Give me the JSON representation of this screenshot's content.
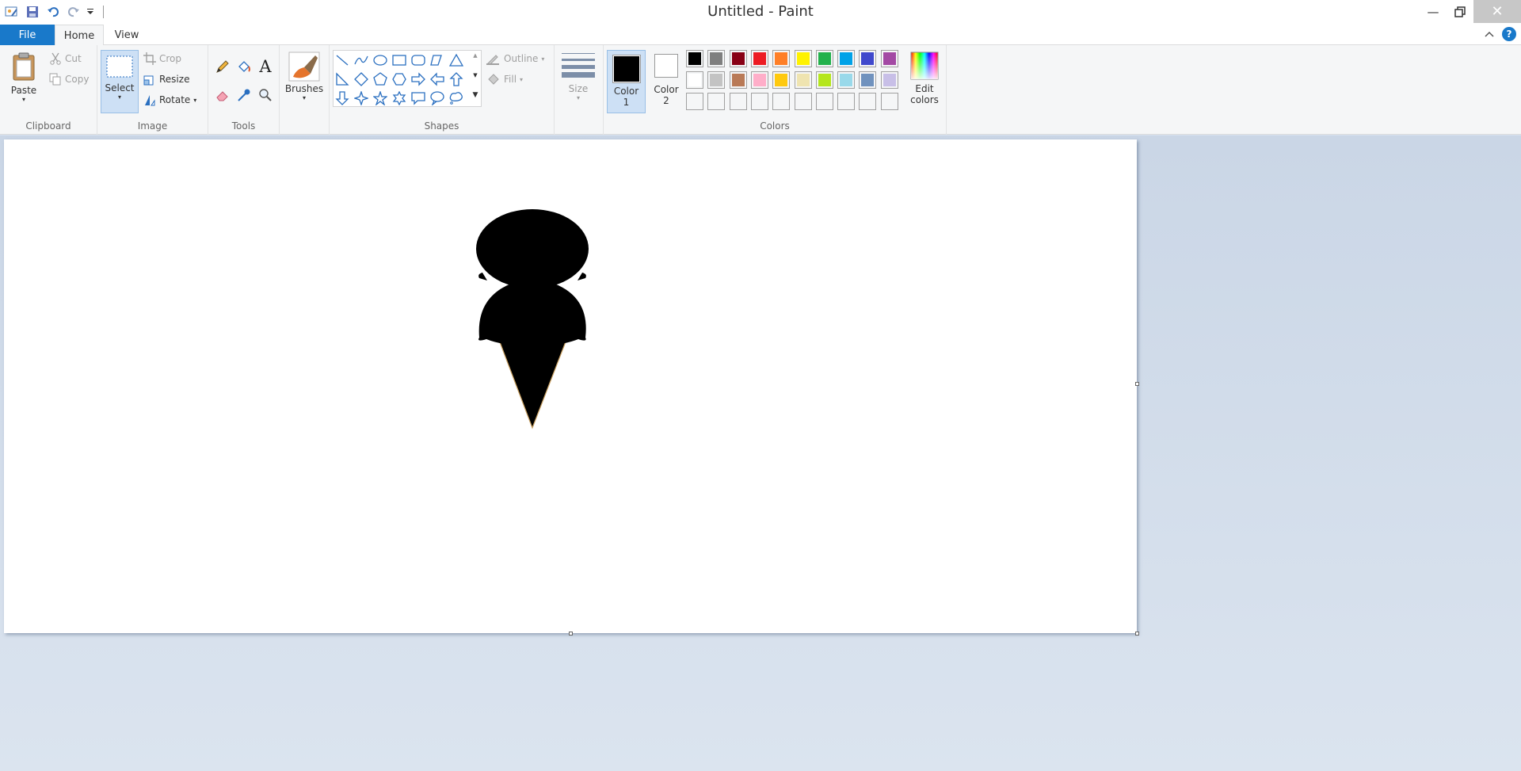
{
  "window": {
    "title": "Untitled - Paint"
  },
  "tabs": {
    "file": "File",
    "home": "Home",
    "view": "View"
  },
  "clipboard": {
    "paste": "Paste",
    "cut": "Cut",
    "copy": "Copy",
    "label": "Clipboard"
  },
  "image": {
    "select": "Select",
    "crop": "Crop",
    "resize": "Resize",
    "rotate": "Rotate",
    "label": "Image"
  },
  "tools": {
    "label": "Tools"
  },
  "brushes": {
    "label": "Brushes"
  },
  "shapes": {
    "outline": "Outline",
    "fill": "Fill",
    "label": "Shapes"
  },
  "size": {
    "label": "Size"
  },
  "colors": {
    "color1": "Color",
    "color1_num": "1",
    "color2": "Color",
    "color2_num": "2",
    "edit": "Edit",
    "edit2": "colors",
    "label": "Colors",
    "color1_value": "#000000",
    "color2_value": "#ffffff",
    "palette_row1": [
      "#000000",
      "#7f7f7f",
      "#880015",
      "#ed1c24",
      "#ff7f27",
      "#fff200",
      "#22b14c",
      "#00a2e8",
      "#3f48cc",
      "#a349a4"
    ],
    "palette_row2": [
      "#ffffff",
      "#c3c3c3",
      "#b97a57",
      "#ffaec9",
      "#ffc90e",
      "#efe4b0",
      "#b5e61d",
      "#99d9ea",
      "#7092be",
      "#c8bfe7"
    ],
    "palette_row3": [
      "#f5f6f7",
      "#f5f6f7",
      "#f5f6f7",
      "#f5f6f7",
      "#f5f6f7",
      "#f5f6f7",
      "#f5f6f7",
      "#f5f6f7",
      "#f5f6f7",
      "#f5f6f7"
    ]
  },
  "canvas": {
    "drawing": "black ice cream cone silhouette"
  }
}
